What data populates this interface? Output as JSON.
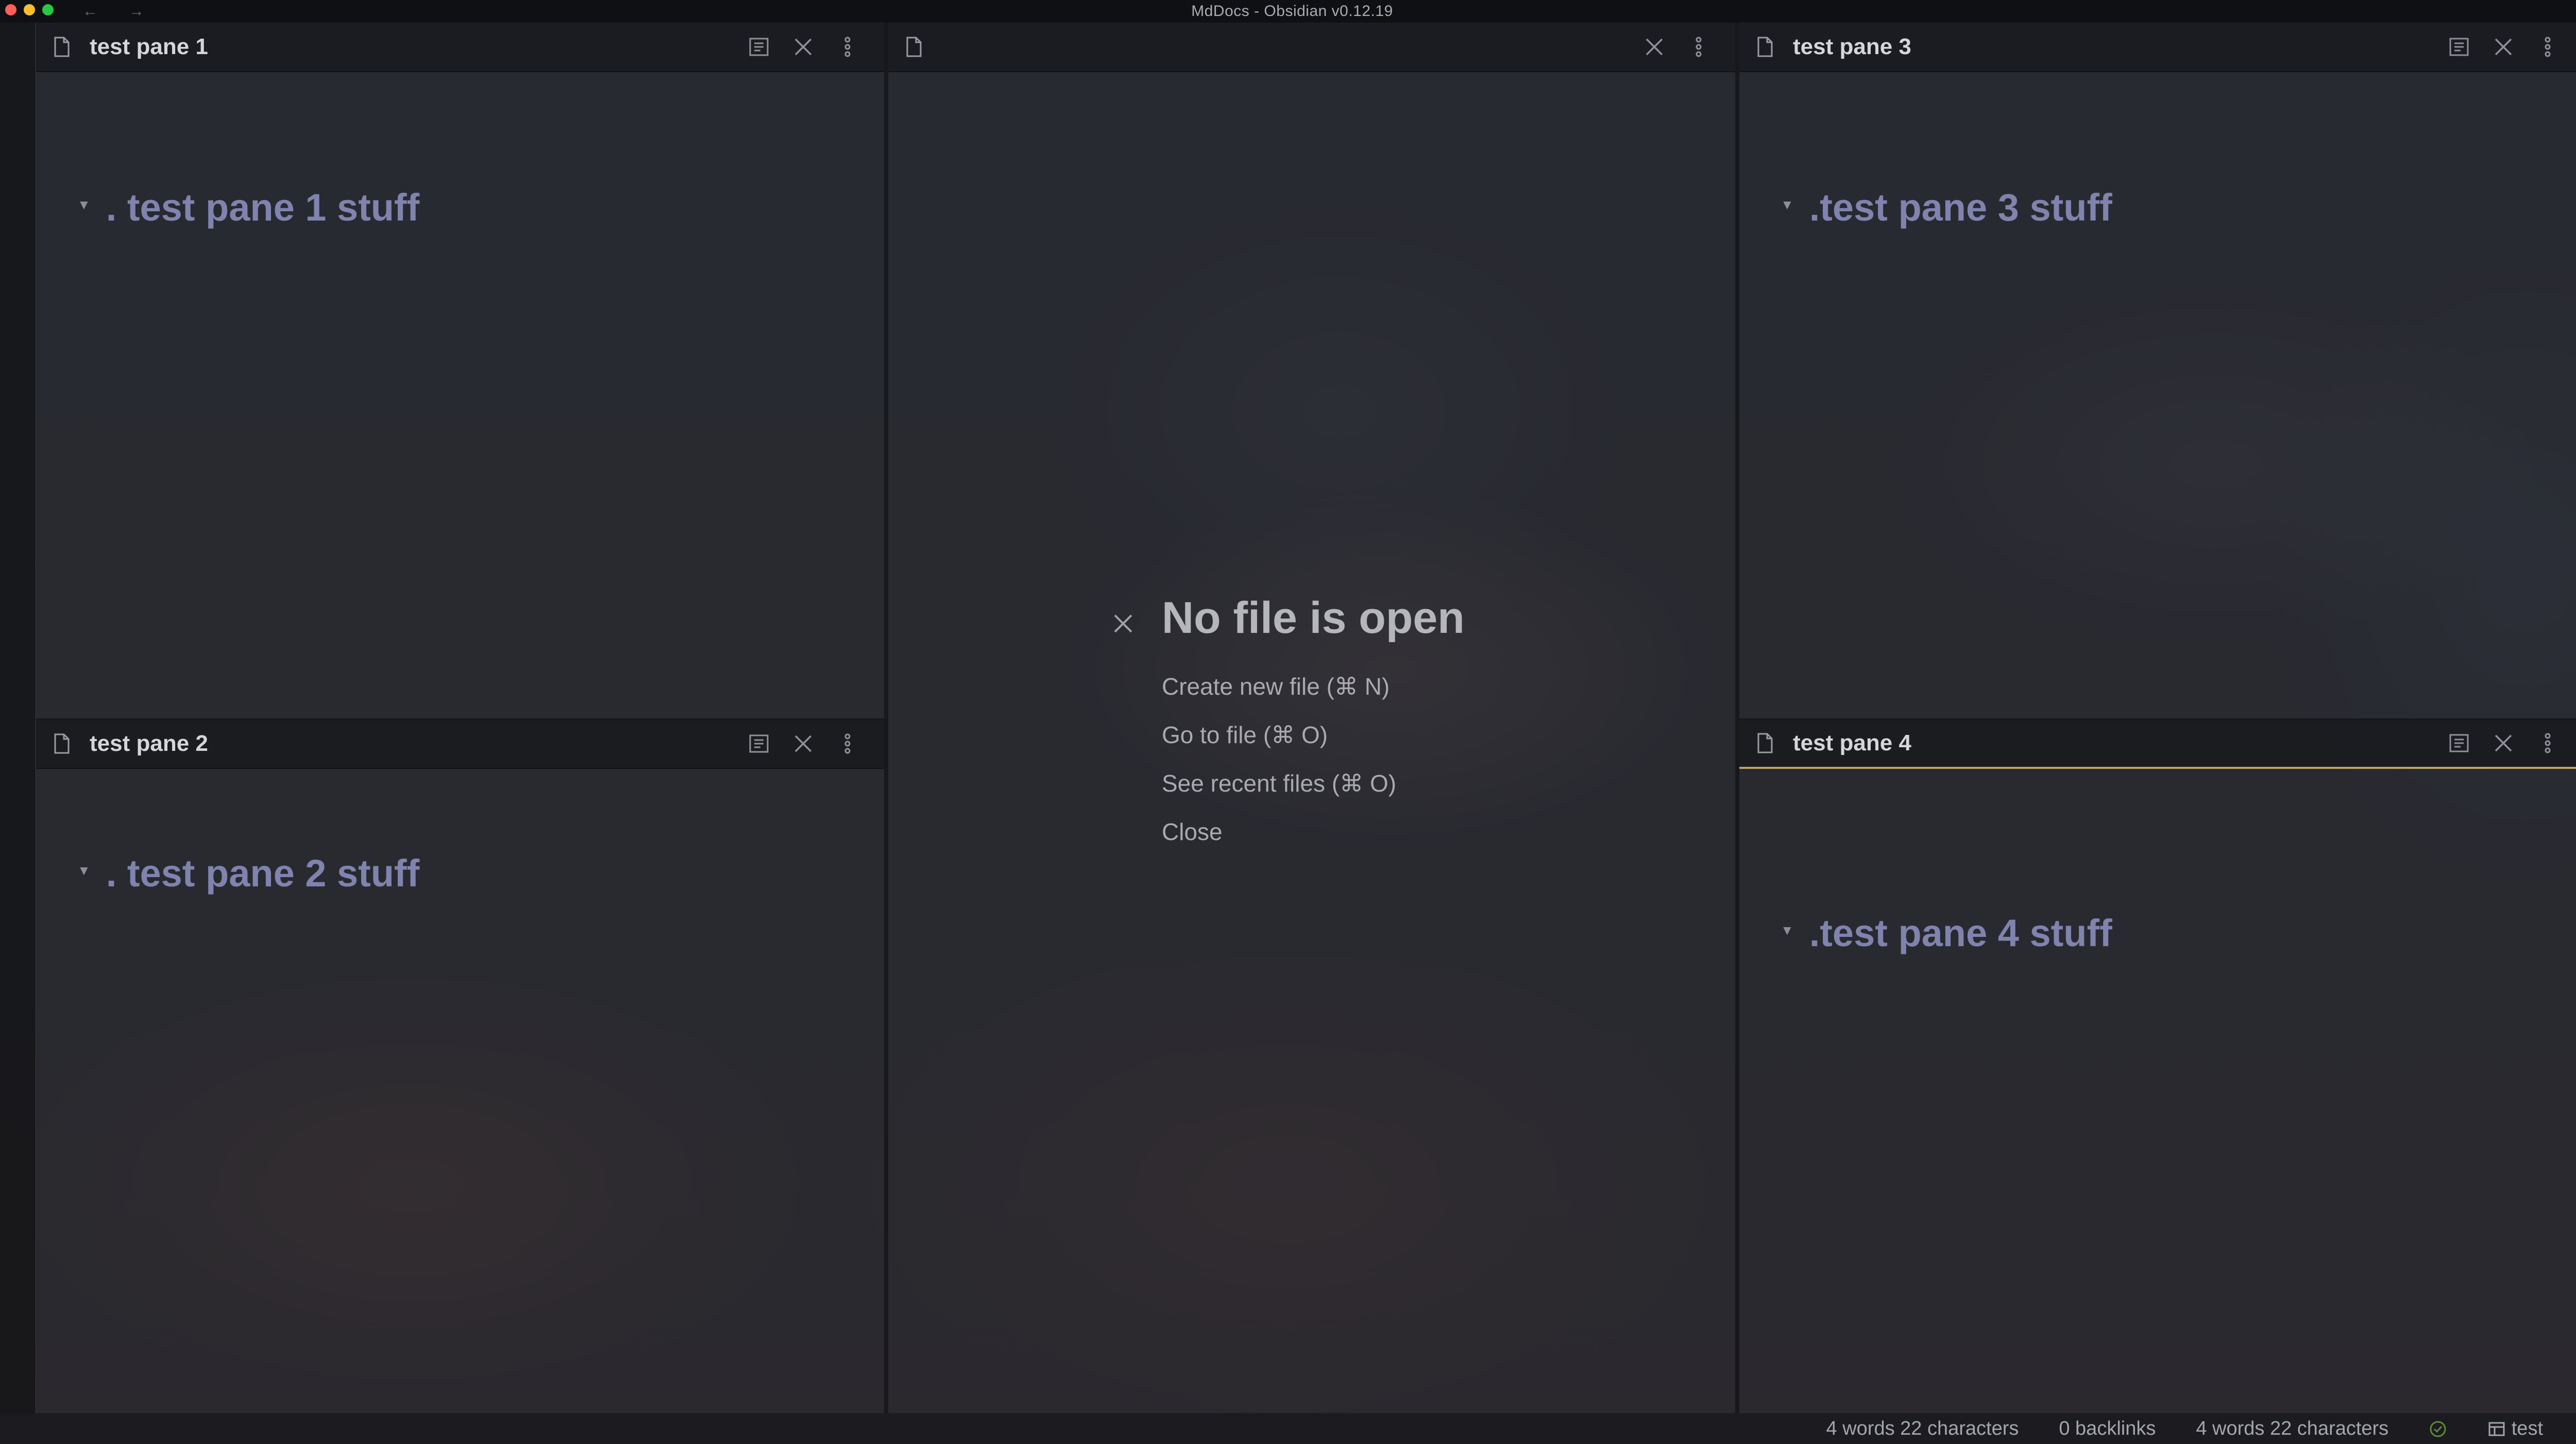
{
  "window": {
    "title": "MdDocs - Obsidian v0.12.19",
    "back_arrow": "←",
    "forward_arrow": "→"
  },
  "panes": [
    {
      "title": "test pane 1",
      "heading": ". test pane 1 stuff",
      "active": false,
      "icons": [
        "reading-view-icon",
        "close-icon",
        "more-options-icon"
      ]
    },
    {
      "title": "test pane 2",
      "heading": ". test pane 2 stuff",
      "active": false,
      "icons": [
        "reading-view-icon",
        "close-icon",
        "more-options-icon"
      ]
    },
    {
      "title": "",
      "heading": "",
      "active": false,
      "icons": [
        "close-icon",
        "more-options-icon"
      ]
    },
    {
      "title": "test pane 3",
      "heading": ".test pane 3 stuff",
      "active": false,
      "icons": [
        "reading-view-icon",
        "close-icon",
        "more-options-icon"
      ]
    },
    {
      "title": "test pane 4",
      "heading": ".test pane 4 stuff",
      "active": true,
      "icons": [
        "reading-view-icon",
        "close-icon",
        "more-options-icon"
      ]
    }
  ],
  "empty_state": {
    "title": "No file is open",
    "actions": [
      "Create new file (⌘ N)",
      "Go to file (⌘ O)",
      "See recent files (⌘ O)",
      "Close"
    ]
  },
  "statusbar": {
    "word_count_1": "4 words 22 characters",
    "backlinks": "0 backlinks",
    "word_count_2": "4 words  22 characters",
    "sync_status_icon": "check-circle-icon",
    "vault_name": "test"
  },
  "colors": {
    "heading": "#7f83ad",
    "active_accent": "#b8a36a",
    "sync_ok": "#5e8a3a"
  }
}
